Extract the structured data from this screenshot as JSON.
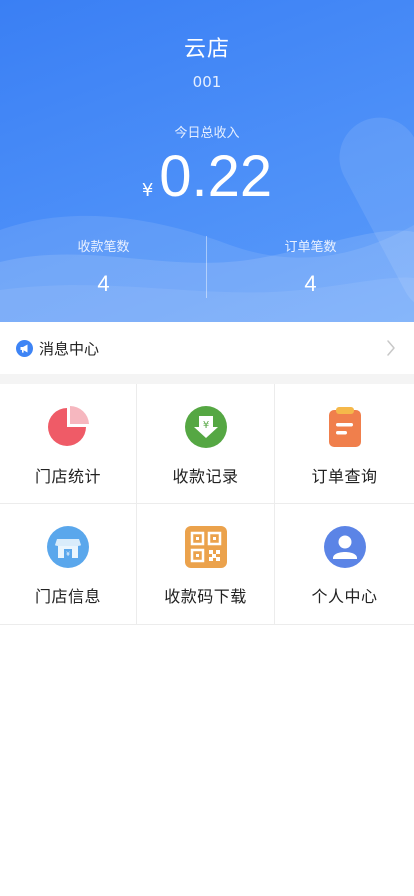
{
  "header": {
    "store_name": "云店",
    "store_code": "001",
    "income_label": "今日总收入",
    "currency_symbol": "¥",
    "income_amount": "0.22",
    "stats": [
      {
        "label": "收款笔数",
        "value": "4"
      },
      {
        "label": "订单笔数",
        "value": "4"
      }
    ]
  },
  "message_center": {
    "label": "消息中心",
    "icon": "megaphone-icon"
  },
  "grid": [
    {
      "label": "门店统计",
      "icon": "pie-chart-icon",
      "color": "#ef5b67"
    },
    {
      "label": "收款记录",
      "icon": "money-download-icon",
      "color": "#55a743"
    },
    {
      "label": "订单查询",
      "icon": "clipboard-icon",
      "color": "#f07f4c"
    },
    {
      "label": "门店信息",
      "icon": "storefront-icon",
      "color": "#5aa7ec"
    },
    {
      "label": "收款码下载",
      "icon": "qr-code-icon",
      "color": "#eba24c"
    },
    {
      "label": "个人中心",
      "icon": "user-icon",
      "color": "#5b84e6"
    }
  ],
  "colors": {
    "header_blue": "#3a7ff4",
    "accent_blue": "#3e84f5"
  }
}
